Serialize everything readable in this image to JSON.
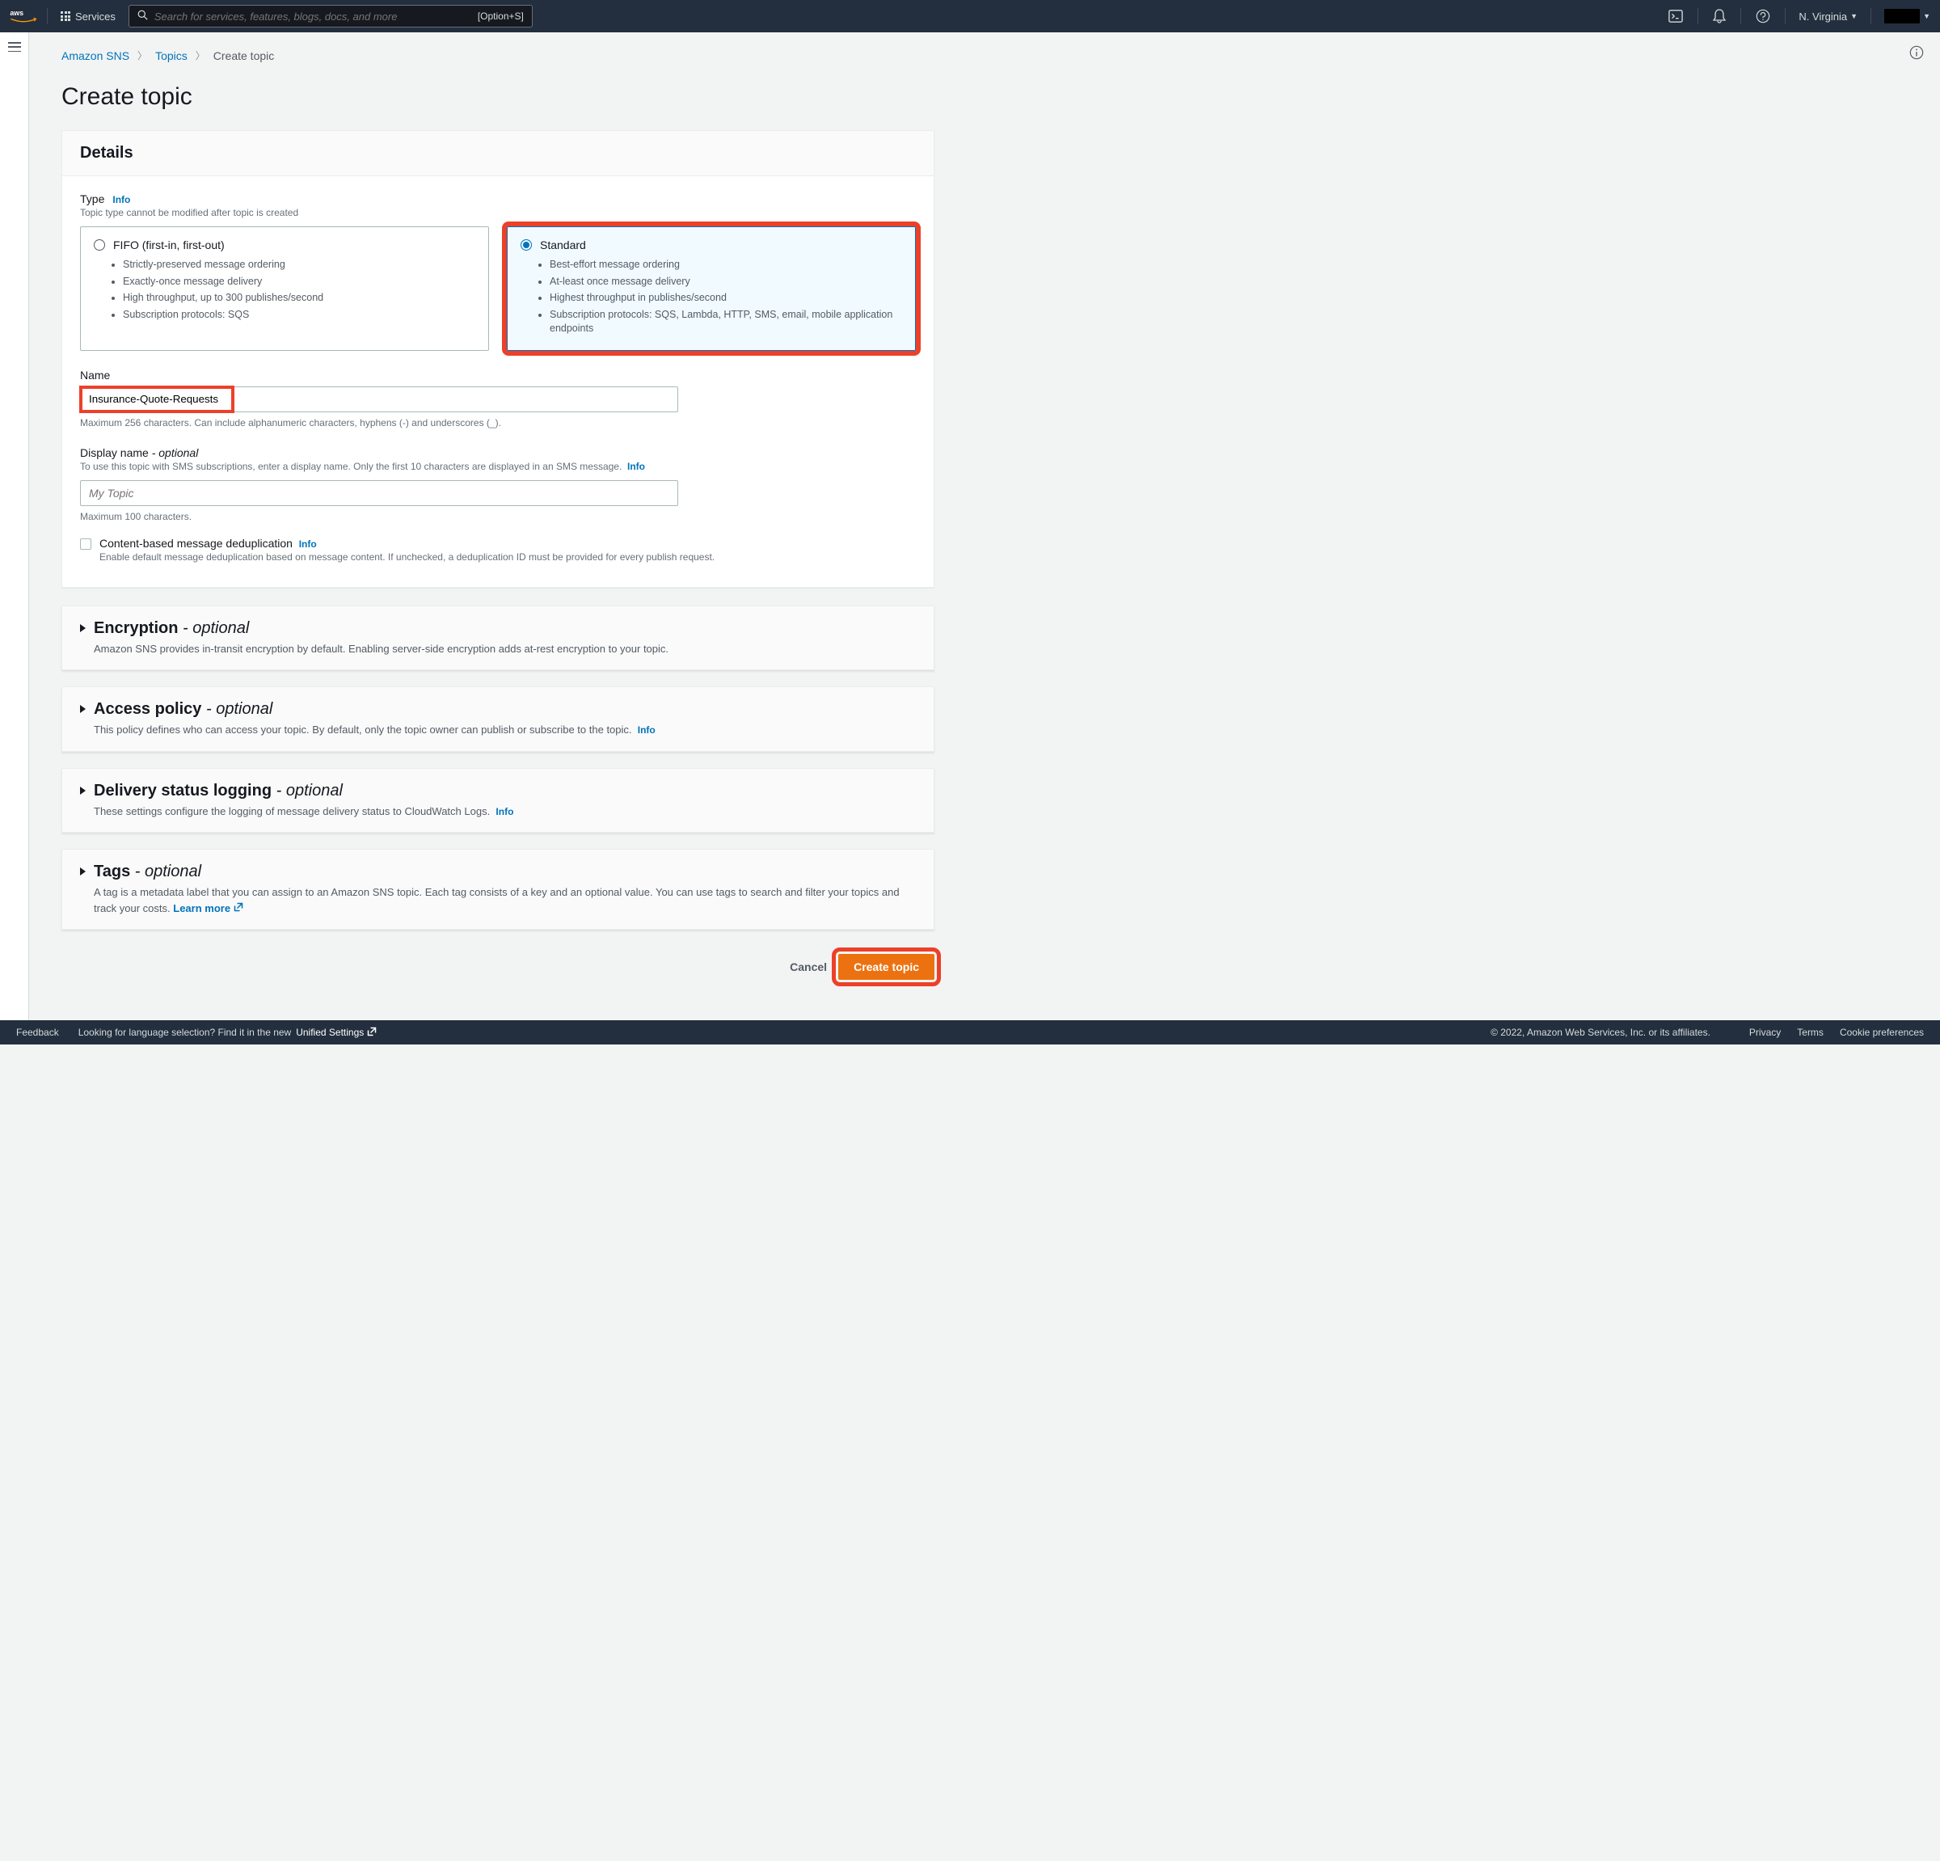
{
  "nav": {
    "services": "Services",
    "search_placeholder": "Search for services, features, blogs, docs, and more",
    "shortcut": "[Option+S]",
    "region": "N. Virginia"
  },
  "breadcrumb": {
    "sns": "Amazon SNS",
    "topics": "Topics",
    "current": "Create topic"
  },
  "page_title": "Create topic",
  "details": {
    "heading": "Details",
    "type_label": "Type",
    "info": "Info",
    "type_hint": "Topic type cannot be modified after topic is created",
    "fifo": {
      "title": "FIFO (first-in, first-out)",
      "b1": "Strictly-preserved message ordering",
      "b2": "Exactly-once message delivery",
      "b3": "High throughput, up to 300 publishes/second",
      "b4": "Subscription protocols: SQS"
    },
    "standard": {
      "title": "Standard",
      "b1": "Best-effort message ordering",
      "b2": "At-least once message delivery",
      "b3": "Highest throughput in publishes/second",
      "b4": "Subscription protocols: SQS, Lambda, HTTP, SMS, email, mobile application endpoints"
    },
    "name_label": "Name",
    "name_value": "Insurance-Quote-Requests",
    "name_hint": "Maximum 256 characters. Can include alphanumeric characters, hyphens (-) and underscores (_).",
    "display_label": "Display name",
    "display_optional": "- optional",
    "display_hint": "To use this topic with SMS subscriptions, enter a display name. Only the first 10 characters are displayed in an SMS message.",
    "display_placeholder": "My Topic",
    "display_below": "Maximum 100 characters.",
    "dedup_label": "Content-based message deduplication",
    "dedup_hint": "Enable default message deduplication based on message content. If unchecked, a deduplication ID must be provided for every publish request."
  },
  "encryption": {
    "title": "Encryption",
    "optional": "- optional",
    "desc": "Amazon SNS provides in-transit encryption by default. Enabling server-side encryption adds at-rest encryption to your topic."
  },
  "access": {
    "title": "Access policy",
    "optional": "- optional",
    "desc": "This policy defines who can access your topic. By default, only the topic owner can publish or subscribe to the topic.",
    "info": "Info"
  },
  "delivery": {
    "title": "Delivery status logging",
    "optional": "- optional",
    "desc": "These settings configure the logging of message delivery status to CloudWatch Logs.",
    "info": "Info"
  },
  "tags": {
    "title": "Tags",
    "optional": "- optional",
    "desc": "A tag is a metadata label that you can assign to an Amazon SNS topic. Each tag consists of a key and an optional value. You can use tags to search and filter your topics and track your costs.",
    "learn": "Learn more"
  },
  "actions": {
    "cancel": "Cancel",
    "create": "Create topic"
  },
  "footer": {
    "feedback": "Feedback",
    "lang_prefix": "Looking for language selection? Find it in the new ",
    "lang_link": "Unified Settings",
    "copyright": "© 2022, Amazon Web Services, Inc. or its affiliates.",
    "privacy": "Privacy",
    "terms": "Terms",
    "cookies": "Cookie preferences"
  }
}
